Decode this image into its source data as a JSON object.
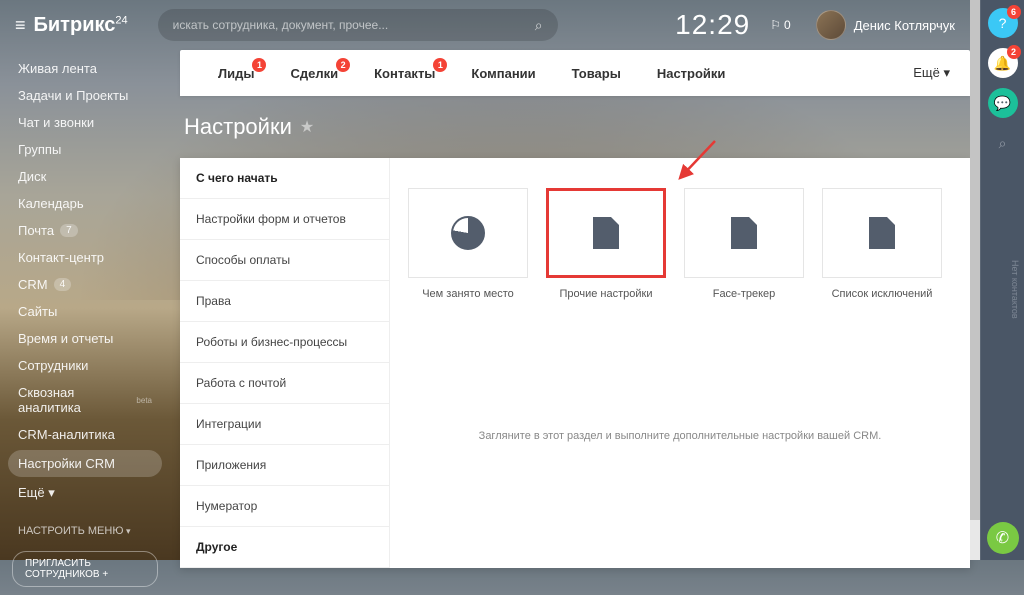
{
  "header": {
    "logo_main": "Битрикс",
    "logo_sub": "24",
    "search_placeholder": "искать сотрудника, документ, прочее...",
    "clock": "12:29",
    "cart_count": "0",
    "user_name": "Денис Котлярчук"
  },
  "left_nav": {
    "items": [
      {
        "label": "Живая лента"
      },
      {
        "label": "Задачи и Проекты"
      },
      {
        "label": "Чат и звонки"
      },
      {
        "label": "Группы"
      },
      {
        "label": "Диск"
      },
      {
        "label": "Календарь"
      },
      {
        "label": "Почта",
        "badge": "7"
      },
      {
        "label": "Контакт-центр"
      },
      {
        "label": "CRM",
        "badge": "4"
      },
      {
        "label": "Сайты"
      },
      {
        "label": "Время и отчеты"
      },
      {
        "label": "Сотрудники"
      },
      {
        "label": "Сквозная аналитика",
        "beta": "beta"
      },
      {
        "label": "CRM-аналитика"
      },
      {
        "label": "Настройки CRM",
        "active": true
      },
      {
        "label": "Ещё ▾"
      }
    ],
    "configure": "НАСТРОИТЬ МЕНЮ",
    "invite": "ПРИГЛАСИТЬ СОТРУДНИКОВ  +"
  },
  "tabs": {
    "items": [
      {
        "label": "Лиды",
        "badge": "1"
      },
      {
        "label": "Сделки",
        "badge": "2"
      },
      {
        "label": "Контакты",
        "badge": "1"
      },
      {
        "label": "Компании"
      },
      {
        "label": "Товары"
      },
      {
        "label": "Настройки"
      }
    ],
    "more": "Ещё ▾"
  },
  "page": {
    "title": "Настройки"
  },
  "side_menu": {
    "items": [
      {
        "label": "С чего начать",
        "bold": true
      },
      {
        "label": "Настройки форм и отчетов"
      },
      {
        "label": "Способы оплаты"
      },
      {
        "label": "Права"
      },
      {
        "label": "Роботы и бизнес-процессы"
      },
      {
        "label": "Работа с почтой"
      },
      {
        "label": "Интеграции"
      },
      {
        "label": "Приложения"
      },
      {
        "label": "Нумератор"
      },
      {
        "label": "Другое",
        "bold": true
      }
    ]
  },
  "tiles": [
    {
      "label": "Чем занято место",
      "icon": "pie"
    },
    {
      "label": "Прочие настройки",
      "icon": "doc",
      "highlighted": true
    },
    {
      "label": "Face-трекер",
      "icon": "doc"
    },
    {
      "label": "Список исключений",
      "icon": "doc"
    }
  ],
  "hint": "Загляните в этот раздел и выполните дополнительные настройки вашей CRM.",
  "right_bar": {
    "help_badge": "6",
    "bell_badge": "2",
    "side_text": "Нет контактов"
  }
}
